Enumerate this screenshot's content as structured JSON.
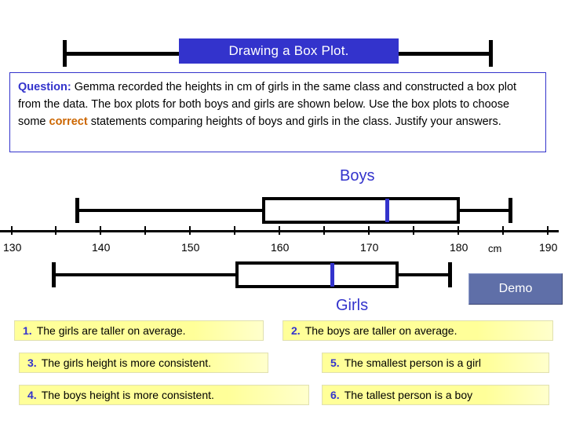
{
  "title": {
    "text": "Drawing a Box Plot."
  },
  "question": {
    "label": "Question",
    "colon": ":",
    "part1": "  Gemma recorded the heights in cm of girls in the same class and constructed a box plot from the data. The box plots for both boys and girls are shown below. Use the box plots to choose some ",
    "emphasis": "correct",
    "part2": " statements comparing heights of boys and girls in the class. Justify your answers."
  },
  "plots": {
    "boys_label": "Boys",
    "girls_label": "Girls"
  },
  "axis": {
    "ticks": [
      "130",
      "140",
      "150",
      "160",
      "170",
      "180",
      "190"
    ],
    "unit": "cm"
  },
  "demo_button": {
    "label": "Demo"
  },
  "statements": [
    {
      "num": "1.",
      "text": "The girls are taller on average."
    },
    {
      "num": "2.",
      "text": "The boys are taller on average."
    },
    {
      "num": "3.",
      "text": "The girls height is more consistent."
    },
    {
      "num": "4.",
      "text": "The boys height is more consistent."
    },
    {
      "num": "5.",
      "text": "The smallest person is a girl"
    },
    {
      "num": "6.",
      "text": "The tallest person is a boy"
    }
  ],
  "colors": {
    "accent_blue": "#3333cc",
    "highlight_orange": "#cc6600",
    "statement_yellow": "#ffff99",
    "demo_button": "#5f6fa8"
  }
}
